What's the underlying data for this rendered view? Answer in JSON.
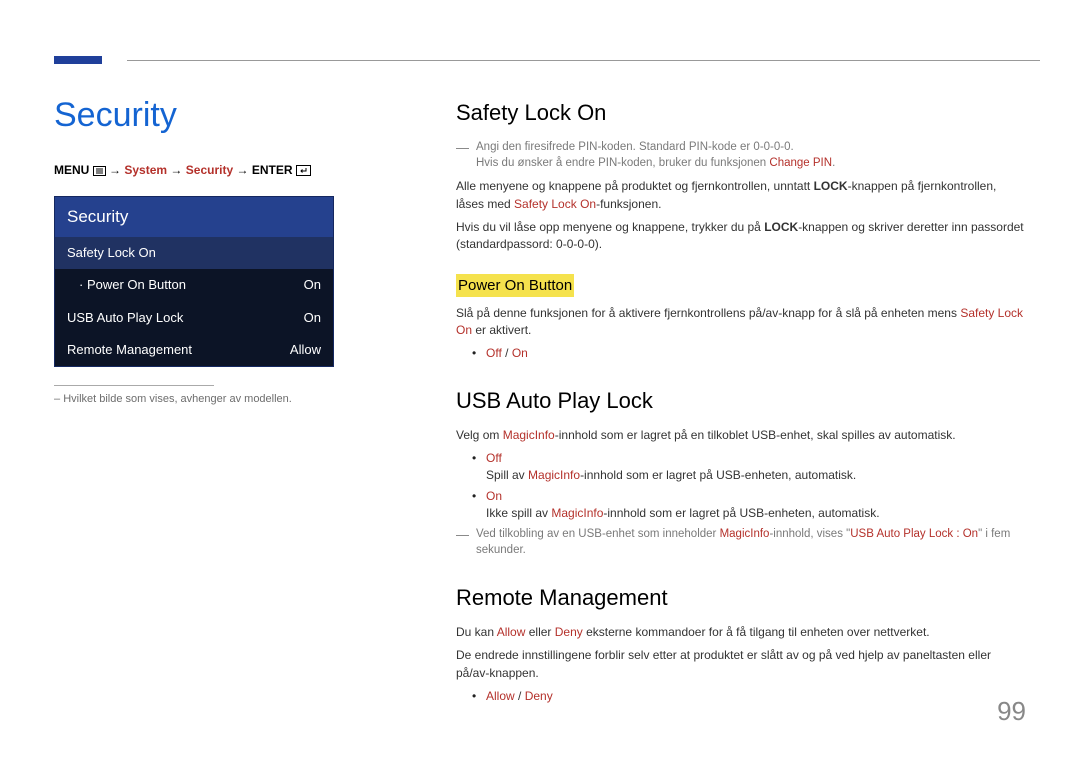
{
  "page_number": "99",
  "title": "Security",
  "breadcrumb": {
    "menu": "MENU",
    "arrow": "→",
    "system": "System",
    "security": "Security",
    "enter": "ENTER"
  },
  "menu_panel": {
    "header": "Security",
    "safety_lock": "Safety Lock On",
    "power_btn_label": "Power On Button",
    "power_btn_value": "On",
    "usb_lock_label": "USB Auto Play Lock",
    "usb_lock_value": "On",
    "remote_label": "Remote Management",
    "remote_value": "Allow"
  },
  "left_note": "Hvilket bilde som vises, avhenger av modellen.",
  "sections": {
    "safety": {
      "heading": "Safety Lock On",
      "foot1a": "Angi den firesifrede PIN-koden. Standard PIN-kode er 0-0-0-0.",
      "foot1b_pre": "Hvis du ønsker å endre PIN-koden, bruker du funksjonen ",
      "foot1b_red": "Change PIN",
      "p1_pre": "Alle menyene og knappene på produktet og fjernkontrollen, unntatt ",
      "p1_bold": "LOCK",
      "p1_mid": "-knappen på fjernkontrollen, låses med ",
      "p1_red": "Safety Lock On",
      "p1_end": "-funksjonen.",
      "p2_pre": "Hvis du vil låse opp menyene og knappene, trykker du på ",
      "p2_bold": "LOCK",
      "p2_end": "-knappen og skriver deretter inn passordet (standardpassord: 0-0-0-0).",
      "sub_heading": "Power On Button",
      "sub_p_pre": "Slå på denne funksjonen for å aktivere fjernkontrollens på/av-knapp for å slå på enheten mens ",
      "sub_p_red": "Safety Lock On",
      "sub_p_end": " er aktivert.",
      "opt_off": "Off",
      "opt_sep": " / ",
      "opt_on": "On"
    },
    "usb": {
      "heading": "USB Auto Play Lock",
      "p_pre": "Velg om ",
      "p_red": "MagicInfo",
      "p_end": "-innhold som er lagret på en tilkoblet USB-enhet, skal spilles av automatisk.",
      "off_label": "Off",
      "off_text_pre": "Spill av ",
      "off_text_red": "MagicInfo",
      "off_text_end": "-innhold som er lagret på USB-enheten, automatisk.",
      "on_label": "On",
      "on_text_pre": "Ikke spill av ",
      "on_text_red": "MagicInfo",
      "on_text_end": "-innhold som er lagret på USB-enheten, automatisk.",
      "foot_pre": "Ved tilkobling av en USB-enhet som inneholder ",
      "foot_red1": "MagicInfo",
      "foot_mid": "-innhold, vises \"",
      "foot_red2": "USB Auto Play Lock : On",
      "foot_end": "\" i fem sekunder."
    },
    "remote": {
      "heading": "Remote Management",
      "p1_pre": "Du kan ",
      "p1_red1": "Allow",
      "p1_mid": " eller ",
      "p1_red2": "Deny",
      "p1_end": " eksterne kommandoer for å få tilgang til enheten over nettverket.",
      "p2": "De endrede innstillingene forblir selv etter at produktet er slått av og på ved hjelp av paneltasten eller på/av-knappen.",
      "opt_allow": "Allow",
      "opt_sep": " / ",
      "opt_deny": "Deny"
    }
  }
}
